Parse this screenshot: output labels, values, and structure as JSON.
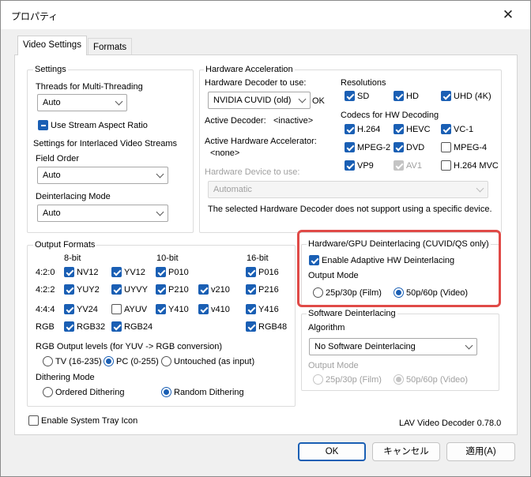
{
  "window": {
    "title": "プロパティ",
    "close_icon": "close-icon"
  },
  "tabs": [
    {
      "label": "Video Settings",
      "active": true
    },
    {
      "label": "Formats",
      "active": false
    }
  ],
  "settings": {
    "title": "Settings",
    "threads_label": "Threads for Multi-Threading",
    "threads_value": "Auto",
    "stream_aspect_label": "Use Stream Aspect Ratio",
    "interlaced_label": "Settings for Interlaced Video Streams",
    "field_order_label": "Field Order",
    "field_order_value": "Auto",
    "deint_mode_label": "Deinterlacing Mode",
    "deint_mode_value": "Auto"
  },
  "hwaccel": {
    "title": "Hardware Acceleration",
    "decoder_label": "Hardware Decoder to use:",
    "decoder_value": "NVIDIA CUVID (old)",
    "decoder_status": "OK",
    "active_decoder_label": "Active Decoder:",
    "active_decoder_value": "<inactive>",
    "active_accel_label": "Active Hardware Accelerator:",
    "active_accel_value": "<none>",
    "device_label": "Hardware Device to use:",
    "device_value": "Automatic",
    "device_note": "The selected Hardware Decoder does not support using a specific device.",
    "resolutions_label": "Resolutions",
    "resolutions": [
      {
        "label": "SD"
      },
      {
        "label": "HD"
      },
      {
        "label": "UHD (4K)"
      }
    ],
    "codecs_label": "Codecs for HW Decoding",
    "codecs": [
      {
        "label": "H.264"
      },
      {
        "label": "HEVC"
      },
      {
        "label": "VC-1"
      },
      {
        "label": "MPEG-2"
      },
      {
        "label": "DVD"
      },
      {
        "label": "MPEG-4"
      },
      {
        "label": "VP9"
      },
      {
        "label": "AV1"
      },
      {
        "label": "H.264 MVC"
      }
    ]
  },
  "output_formats": {
    "title": "Output Formats",
    "headers": {
      "bit8": "8-bit",
      "bit10": "10-bit",
      "bit16": "16-bit"
    },
    "rows": {
      "r420": "4:2:0",
      "r422": "4:2:2",
      "r444": "4:4:4",
      "rgb": "RGB"
    },
    "formats": {
      "nv12": "NV12",
      "yv12": "YV12",
      "p010": "P010",
      "p016": "P016",
      "yuy2": "YUY2",
      "uyvy": "UYVY",
      "p210": "P210",
      "v210": "v210",
      "p216": "P216",
      "yv24": "YV24",
      "ayuv": "AYUV",
      "y410": "Y410",
      "v410": "v410",
      "y416": "Y416",
      "rgb32": "RGB32",
      "rgb24": "RGB24",
      "rgb48": "RGB48"
    },
    "levels_label": "RGB Output levels (for YUV -> RGB conversion)",
    "levels": {
      "tv": "TV (16-235)",
      "pc": "PC (0-255)",
      "untouched": "Untouched (as input)"
    },
    "dither_label": "Dithering Mode",
    "dither": {
      "ordered": "Ordered Dithering",
      "random": "Random Dithering"
    }
  },
  "hw_deint": {
    "title": "Hardware/GPU Deinterlacing (CUVID/QS only)",
    "adaptive_label": "Enable Adaptive HW Deinterlacing",
    "output_mode_label": "Output Mode",
    "film": "25p/30p (Film)",
    "video": "50p/60p (Video)"
  },
  "sw_deint": {
    "title": "Software Deinterlacing",
    "algorithm_label": "Algorithm",
    "algorithm_value": "No Software Deinterlacing",
    "output_mode_label": "Output Mode",
    "film": "25p/30p (Film)",
    "video": "50p/60p (Video)"
  },
  "tray_label": "Enable System Tray Icon",
  "version": "LAV Video Decoder 0.78.0",
  "buttons": {
    "ok": "OK",
    "cancel": "キャンセル",
    "apply": "適用(A)"
  },
  "colors": {
    "accent": "#1a5fb4",
    "highlight": "#e04a47"
  }
}
